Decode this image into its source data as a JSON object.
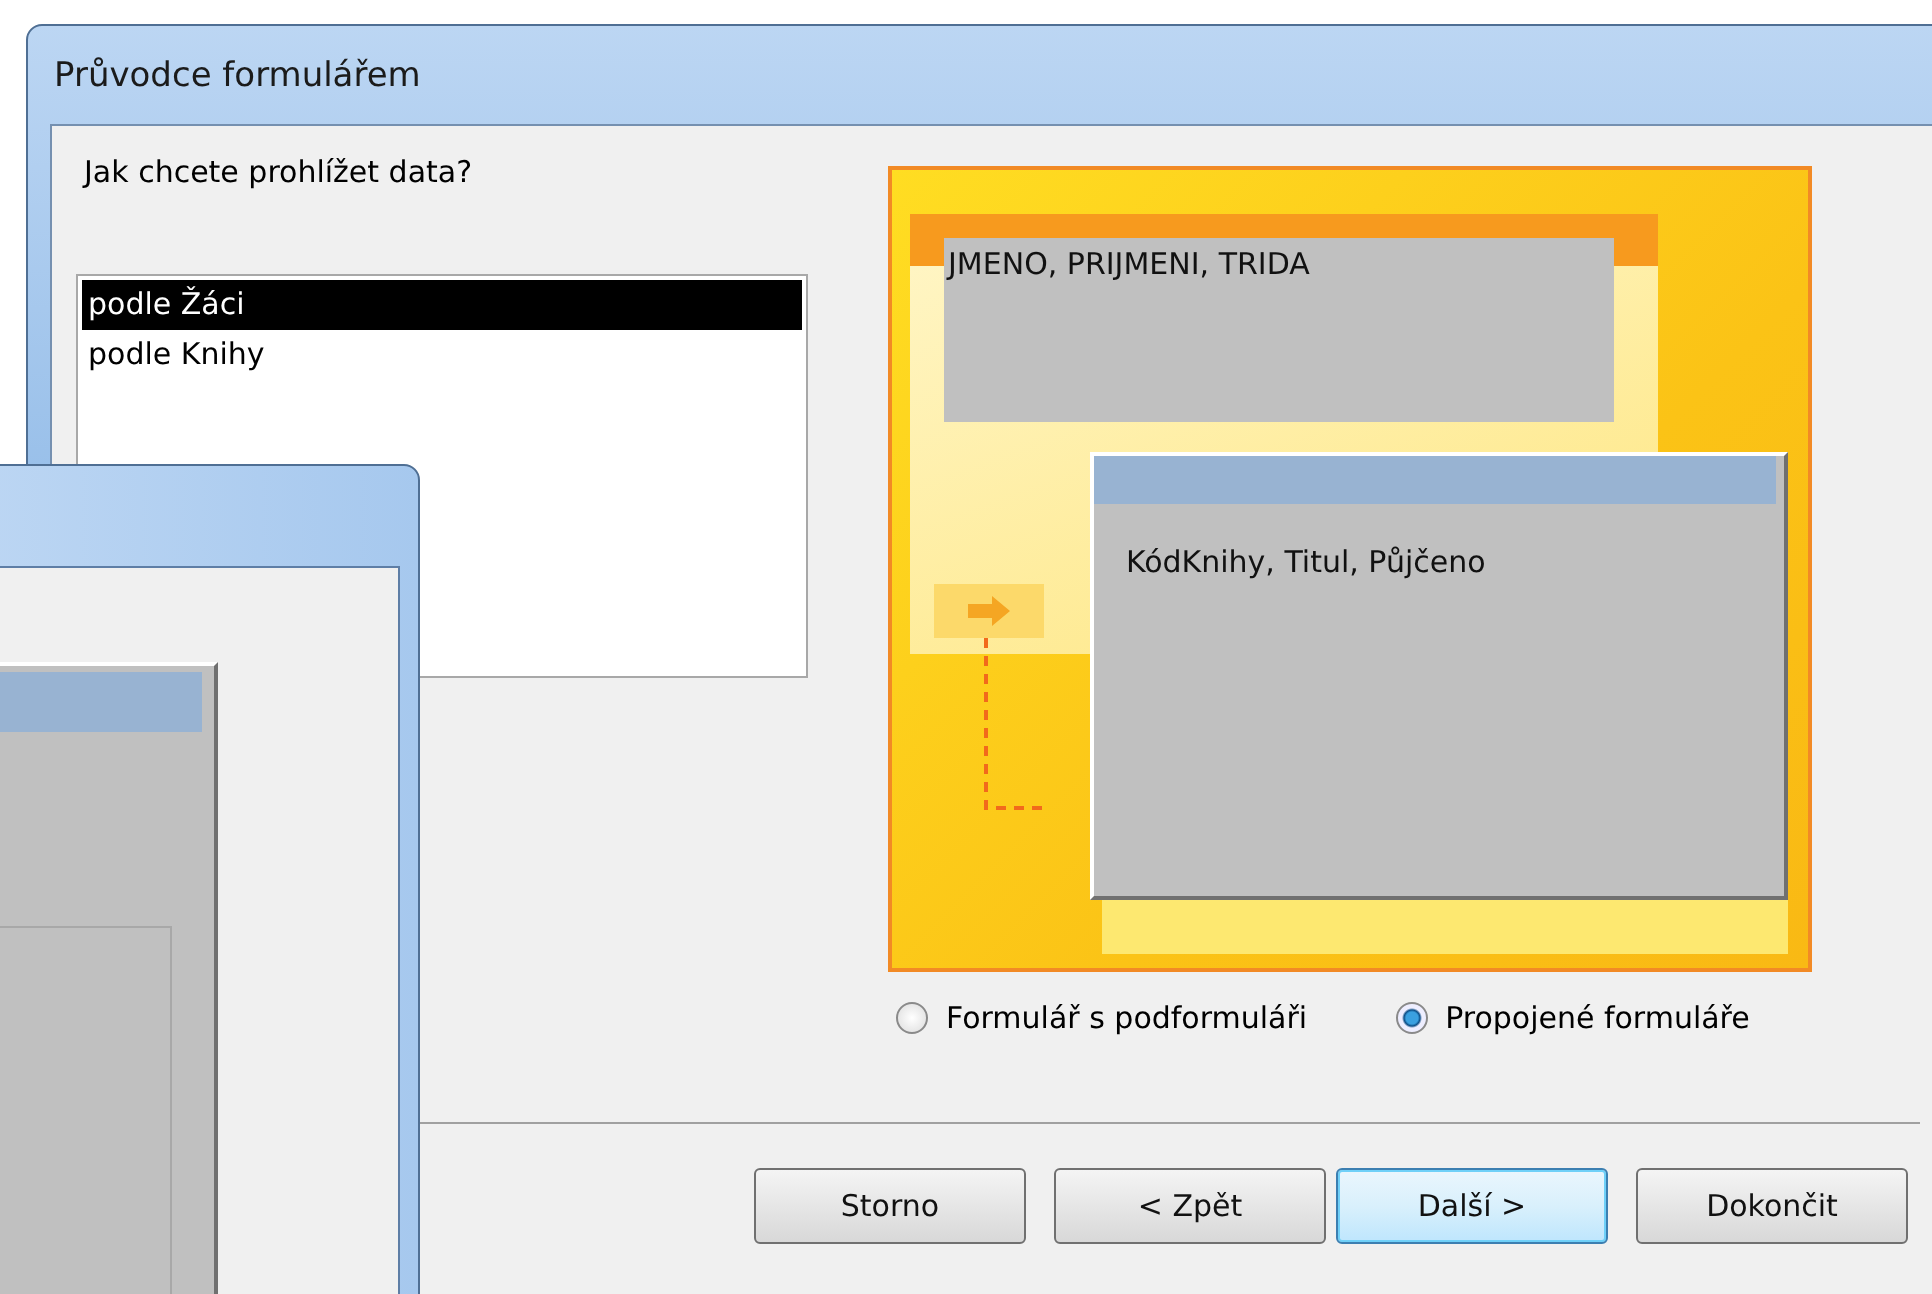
{
  "window": {
    "title": "Průvodce formulářem"
  },
  "prompt": "Jak chcete prohlížet data?",
  "view_list": [
    {
      "label": "podle Žáci",
      "selected": true
    },
    {
      "label": "podle Knihy",
      "selected": false
    }
  ],
  "preview": {
    "main_form_fields": "JMENO, PRIJMENI, TRIDA",
    "linked_form_fields": "KódKnihy, Titul, Půjčeno"
  },
  "layout_options": [
    {
      "label": "Formulář s podformuláři",
      "selected": false
    },
    {
      "label": "Propojené formuláře",
      "selected": true
    }
  ],
  "buttons": [
    {
      "label": "Storno",
      "default": false
    },
    {
      "label": "< Zpět",
      "default": false
    },
    {
      "label": "Další >",
      "default": true
    },
    {
      "label": "Dokončit",
      "default": false
    }
  ]
}
